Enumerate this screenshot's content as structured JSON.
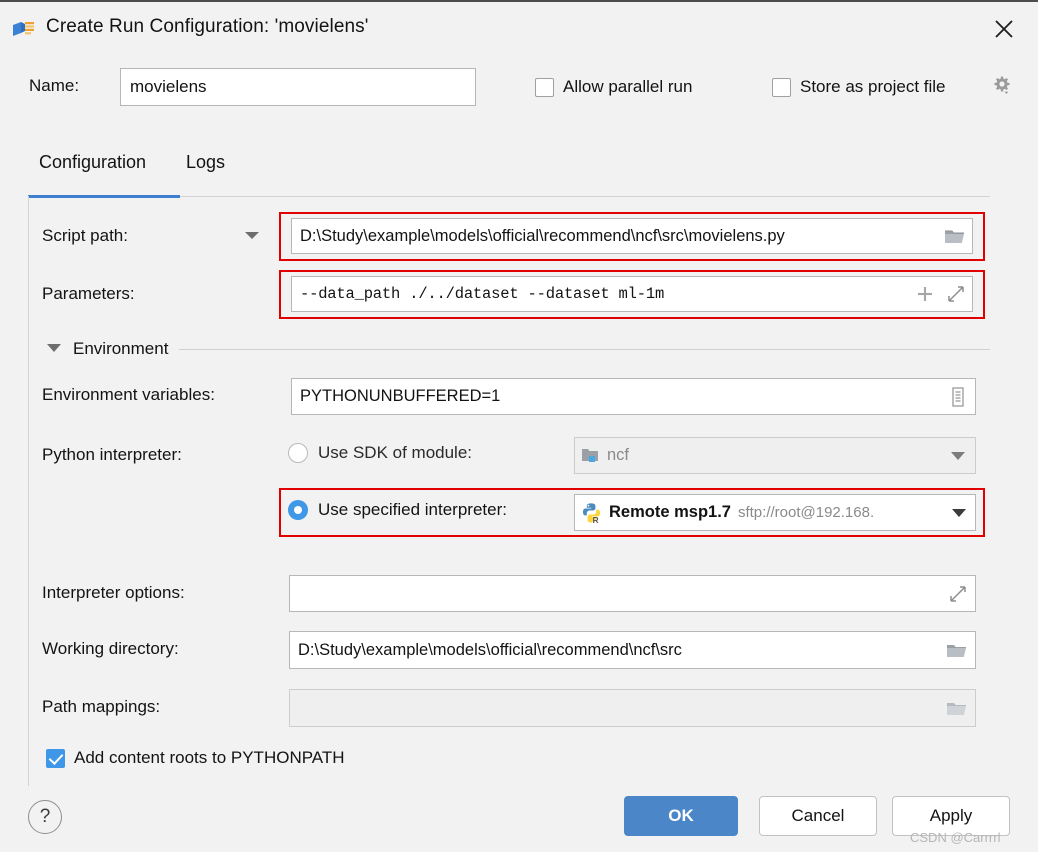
{
  "window": {
    "title": "Create Run Configuration: 'movielens'",
    "app_icon": "run-configuration-icon",
    "close_icon": "close-icon"
  },
  "header": {
    "name_label": "Name:",
    "name_value": "movielens",
    "allow_parallel_run": {
      "label": "Allow parallel run",
      "checked": false
    },
    "store_as_project_file": {
      "label": "Store as project file",
      "checked": false
    },
    "gear_icon": "gear-dropdown-icon"
  },
  "tabs": [
    {
      "label": "Configuration",
      "active": true
    },
    {
      "label": "Logs",
      "active": false
    }
  ],
  "form": {
    "script_path": {
      "label": "Script path:",
      "value": "D:\\Study\\example\\models\\official\\recommend\\ncf\\src\\movielens.py",
      "browse_icon": "folder-icon",
      "caret_icon": "chevron-down-icon",
      "highlighted": true
    },
    "parameters": {
      "label": "Parameters:",
      "value": "--data_path ./../dataset --dataset ml-1m",
      "insert_macro_icon": "plus-icon",
      "expand_icon": "expand-icon",
      "highlighted": true
    },
    "environment_section": {
      "label": "Environment",
      "collapse_icon": "triangle-down-icon",
      "expanded": true
    },
    "environment_variables": {
      "label": "Environment variables:",
      "value": "PYTHONUNBUFFERED=1",
      "edit_icon": "list-edit-icon"
    },
    "python_interpreter": {
      "label": "Python interpreter:",
      "option_sdk_module": {
        "label": "Use SDK of module:",
        "selected": false,
        "disabled": true,
        "value": "ncf",
        "module_icon": "module-folder-icon",
        "caret_icon": "chevron-down-icon"
      },
      "option_specified": {
        "label": "Use specified interpreter:",
        "selected": true,
        "value_name": "Remote msp1.7",
        "value_detail": "sftp://root@192.168.",
        "interpreter_icon": "python-remote-icon",
        "caret_icon": "chevron-down-icon",
        "highlighted": true
      }
    },
    "interpreter_options": {
      "label": "Interpreter options:",
      "value": "",
      "expand_icon": "expand-icon"
    },
    "working_directory": {
      "label": "Working directory:",
      "value": "D:\\Study\\example\\models\\official\\recommend\\ncf\\src",
      "browse_icon": "folder-icon"
    },
    "path_mappings": {
      "label": "Path mappings:",
      "value": "",
      "disabled": true,
      "browse_icon": "folder-icon"
    },
    "add_content_roots": {
      "label": "Add content roots to PYTHONPATH",
      "checked": true
    }
  },
  "footer": {
    "help_label": "?",
    "ok_label": "OK",
    "cancel_label": "Cancel",
    "apply_label": "Apply",
    "watermark": "CSDN @Carrrrl"
  },
  "colors": {
    "accent_blue": "#3f97e8",
    "ok_button": "#4a86c8",
    "highlight_red": "#e00000",
    "tab_underline": "#3f7fd2",
    "window_bg": "#f2f2f2"
  }
}
